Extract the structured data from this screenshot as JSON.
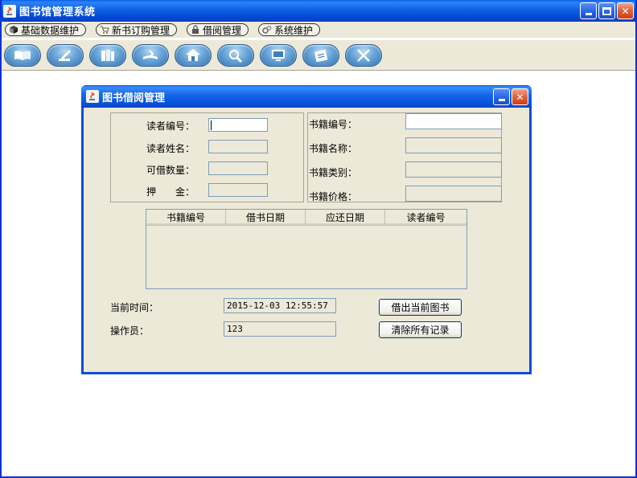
{
  "window": {
    "title": "图书馆管理系统"
  },
  "menu": [
    {
      "label": "基础数据维护",
      "icon": "cube-icon"
    },
    {
      "label": "新书订购管理",
      "icon": "cart-icon"
    },
    {
      "label": "借阅管理",
      "icon": "lock-icon"
    },
    {
      "label": "系统维护",
      "icon": "gears-icon"
    }
  ],
  "toolbar": {
    "icons": [
      "open-book-icon",
      "pen-write-icon",
      "books-icon",
      "book-return-icon",
      "house-icon",
      "magnifier-book-icon",
      "monitor-icon",
      "calendar-icon",
      "tools-icon"
    ]
  },
  "borrow_frame": {
    "title": "图书借阅管理",
    "reader": {
      "id_label": "读者编号：",
      "id_value": "",
      "name_label": "读者姓名：",
      "name_value": "",
      "quota_label": "可借数量：",
      "quota_value": "",
      "deposit_label": "押　　金：",
      "deposit_value": ""
    },
    "book": {
      "id_label": "书籍编号：",
      "id_value": "",
      "name_label": "书籍名称：",
      "name_value": "",
      "type_label": "书籍类别：",
      "type_value": "",
      "price_label": "书籍价格：",
      "price_value": ""
    },
    "table": {
      "columns": [
        "书籍编号",
        "借书日期",
        "应还日期",
        "读者编号"
      ],
      "rows": []
    },
    "current_time_label": "当前时间：",
    "current_time_value": "2015-12-03 12:55:57",
    "operator_label": "操作员：",
    "operator_value": "123",
    "borrow_button": "借出当前图书",
    "clear_button": "清除所有记录"
  }
}
